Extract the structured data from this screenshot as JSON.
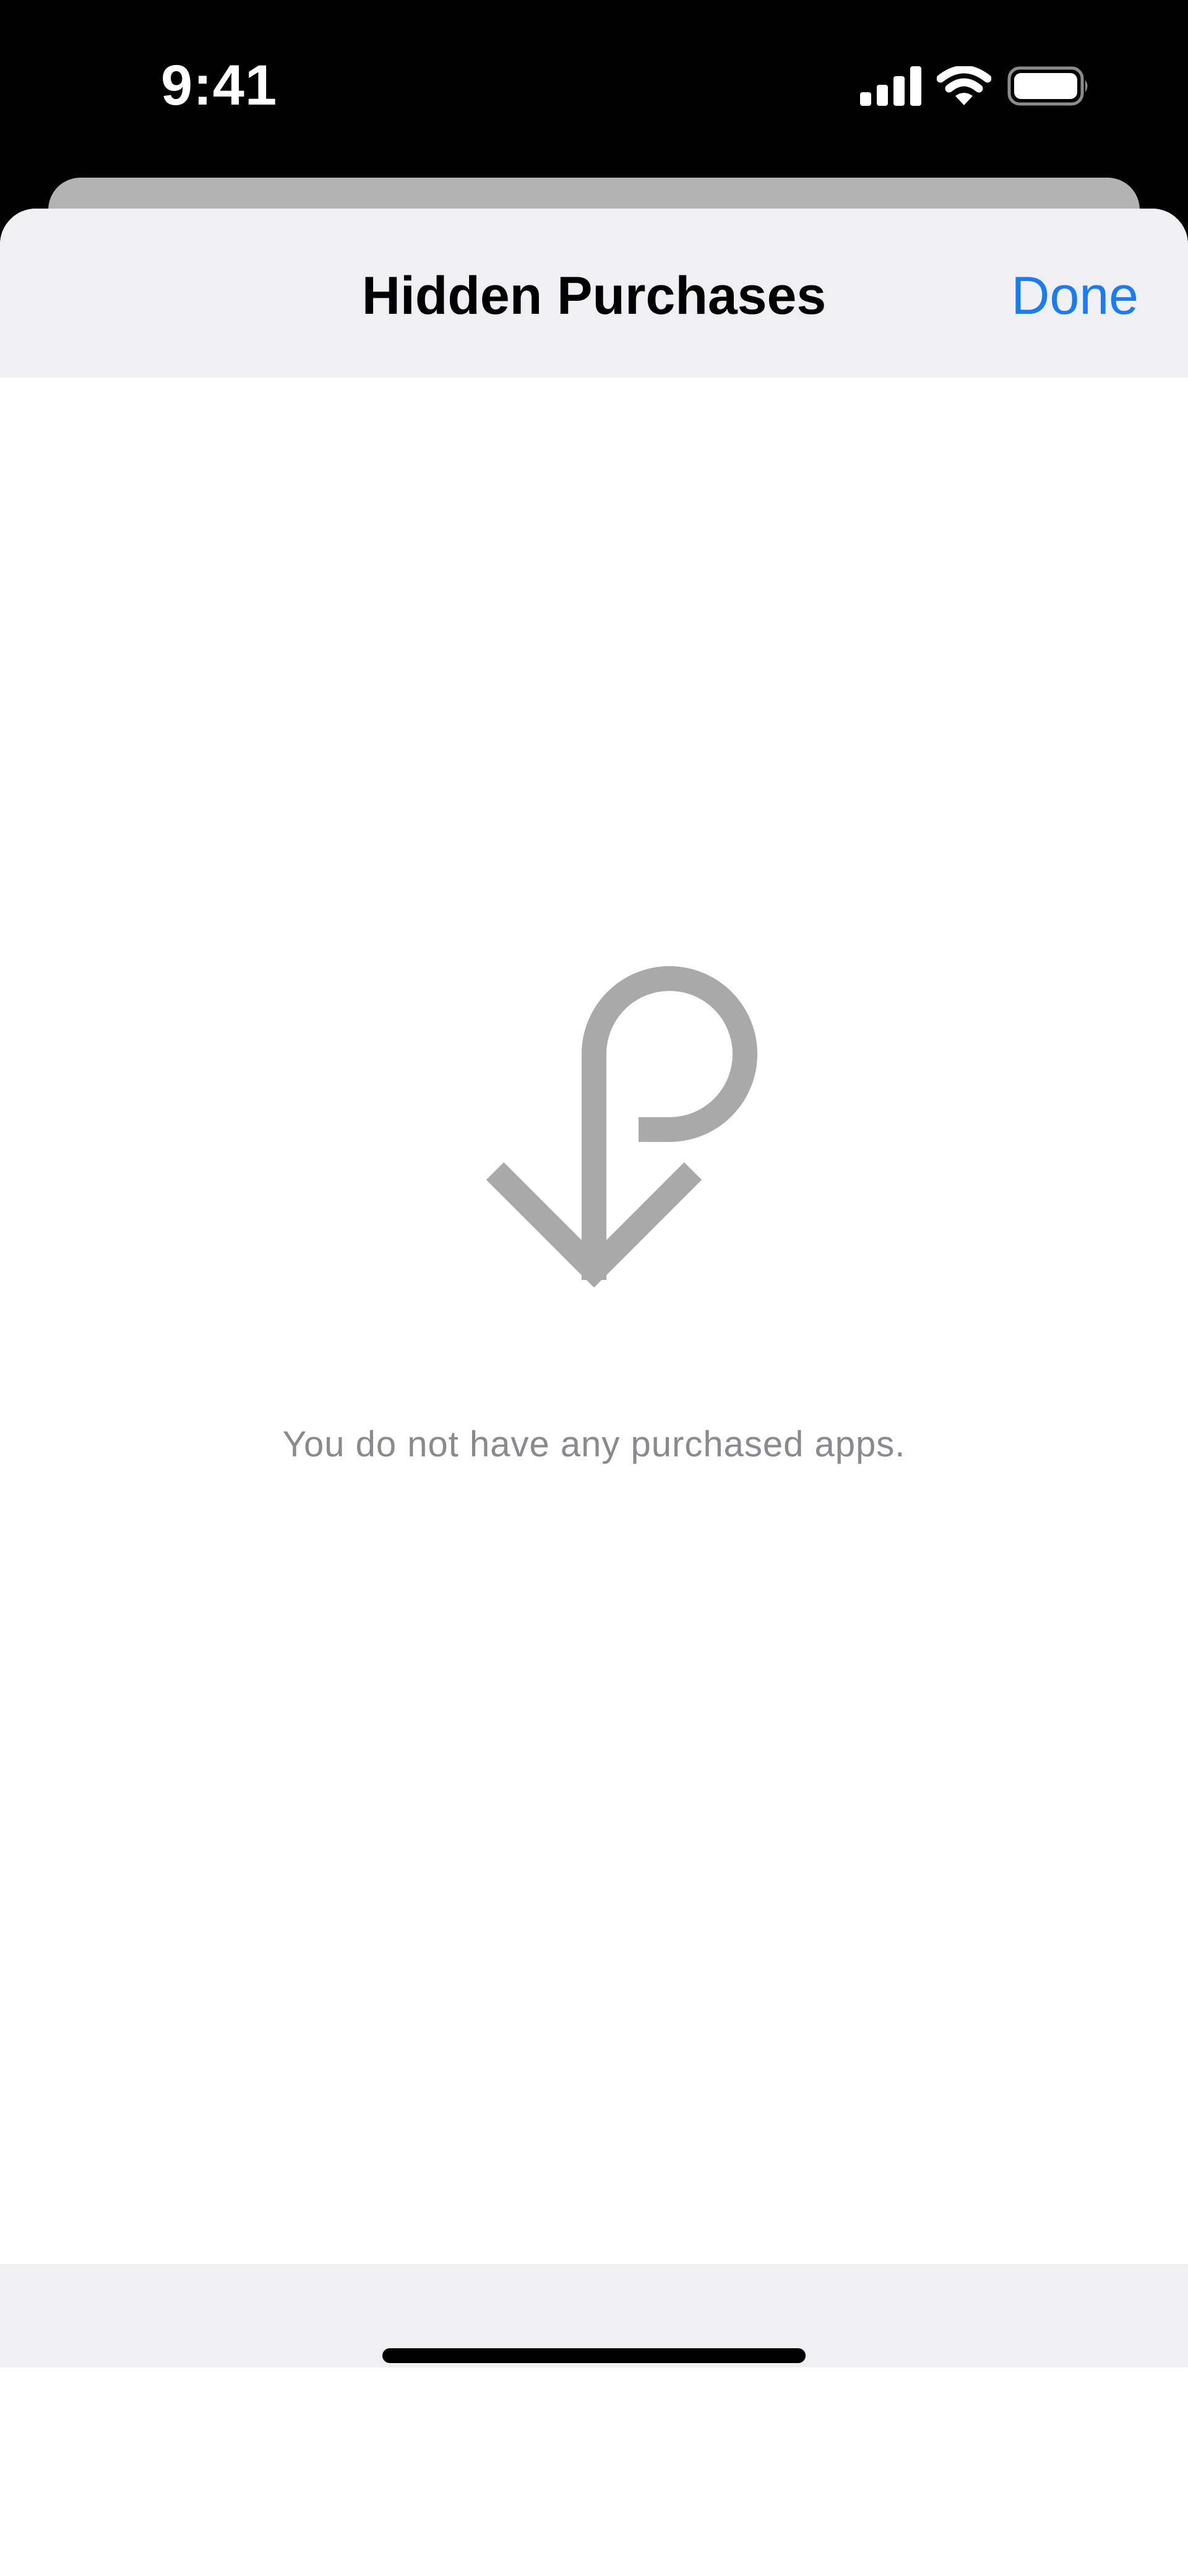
{
  "status_bar": {
    "time": "9:41",
    "icons": [
      "cellular-signal-icon",
      "wifi-icon",
      "battery-icon"
    ]
  },
  "nav": {
    "title": "Hidden Purchases",
    "done_label": "Done"
  },
  "empty_state": {
    "icon": "purchases-download-arrow-icon",
    "message": "You do not have any purchased apps."
  },
  "colors": {
    "accent": "#1a7cf0",
    "nav_background": "#efeff4",
    "icon_gray": "#a9a9a9",
    "message_gray": "#8a8a8e"
  }
}
